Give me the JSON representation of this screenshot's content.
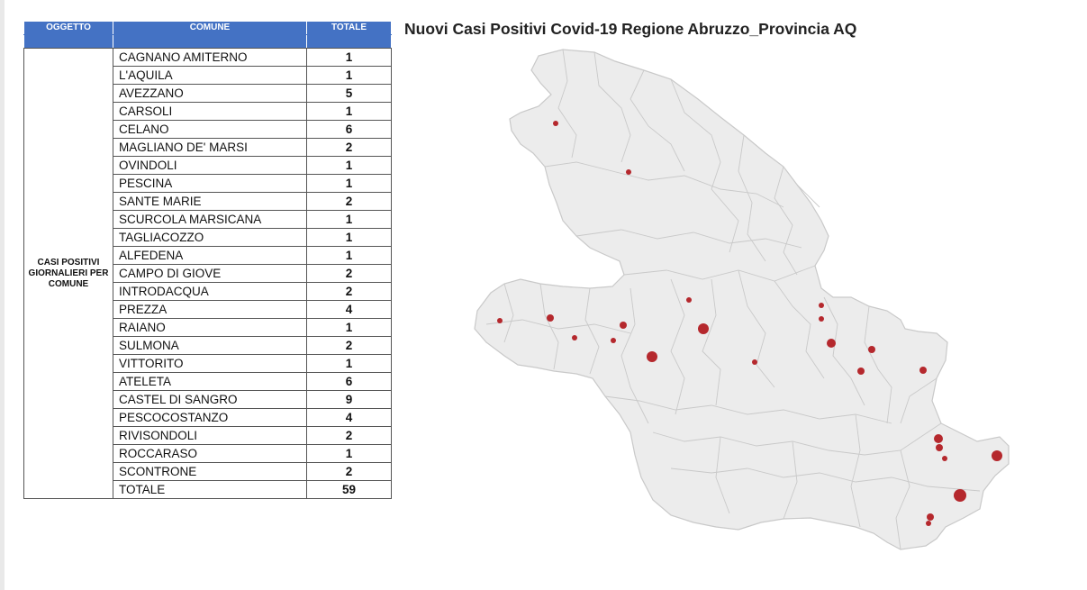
{
  "table": {
    "headers": {
      "oggetto": "OGGETTO",
      "comune": "COMUNE",
      "totale": "TOTALE"
    },
    "group_label": "CASI POSITIVI GIORNALIERI PER COMUNE",
    "rows": [
      {
        "comune": "CAGNANO AMITERNO",
        "totale": "1"
      },
      {
        "comune": "L'AQUILA",
        "totale": "1"
      },
      {
        "comune": "AVEZZANO",
        "totale": "5"
      },
      {
        "comune": "CARSOLI",
        "totale": "1"
      },
      {
        "comune": "CELANO",
        "totale": "6"
      },
      {
        "comune": "MAGLIANO DE' MARSI",
        "totale": "2"
      },
      {
        "comune": "OVINDOLI",
        "totale": "1"
      },
      {
        "comune": "PESCINA",
        "totale": "1"
      },
      {
        "comune": "SANTE MARIE",
        "totale": "2"
      },
      {
        "comune": "SCURCOLA MARSICANA",
        "totale": "1"
      },
      {
        "comune": "TAGLIACOZZO",
        "totale": "1"
      },
      {
        "comune": "ALFEDENA",
        "totale": "1"
      },
      {
        "comune": "CAMPO DI GIOVE",
        "totale": "2"
      },
      {
        "comune": "INTRODACQUA",
        "totale": "2"
      },
      {
        "comune": "PREZZA",
        "totale": "4"
      },
      {
        "comune": "RAIANO",
        "totale": "1"
      },
      {
        "comune": "SULMONA",
        "totale": "2"
      },
      {
        "comune": "VITTORITO",
        "totale": "1"
      },
      {
        "comune": "ATELETA",
        "totale": "6"
      },
      {
        "comune": "CASTEL DI SANGRO",
        "totale": "9"
      },
      {
        "comune": "PESCOCOSTANZO",
        "totale": "4"
      },
      {
        "comune": "RIVISONDOLI",
        "totale": "2"
      },
      {
        "comune": "ROCCARASO",
        "totale": "1"
      },
      {
        "comune": "SCONTRONE",
        "totale": "2"
      }
    ],
    "total_row": {
      "comune": "TOTALE",
      "totale": "59"
    }
  },
  "map": {
    "title": "Nuovi Casi Positivi Covid-19 Regione Abruzzo_Provincia AQ",
    "fill_color": "#ececec",
    "border_color": "#c9c9c9",
    "marker_color": "#b5282d"
  }
}
